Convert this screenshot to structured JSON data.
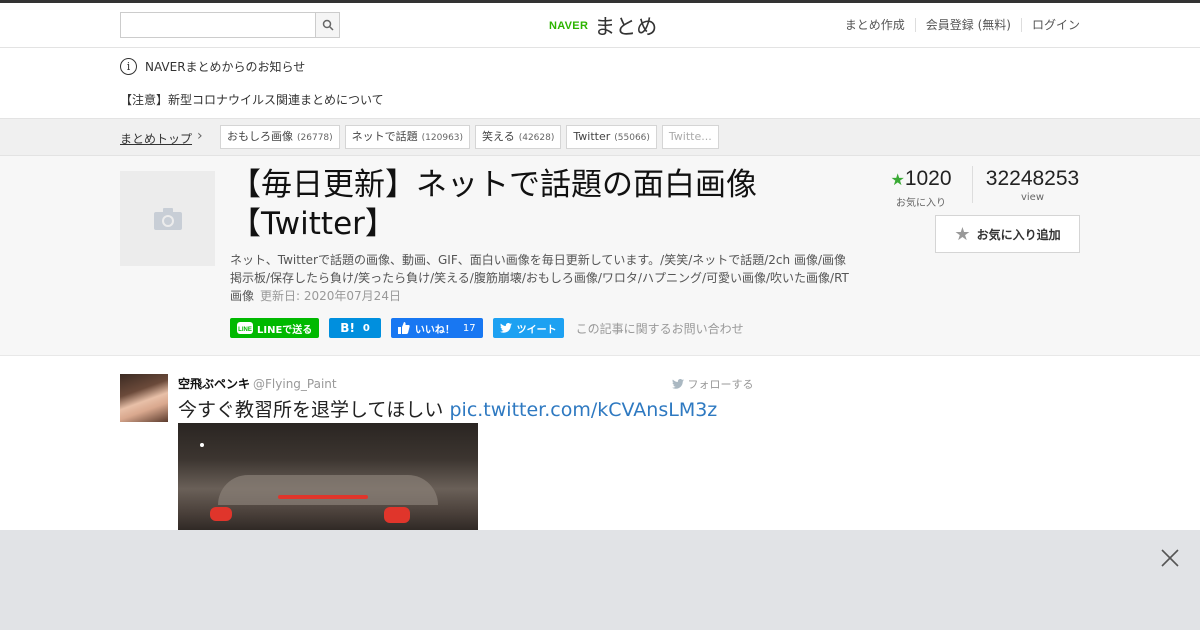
{
  "header": {
    "search_placeholder": "",
    "logo_naver": "NAVER",
    "logo_matome": "まとめ",
    "nav": [
      "まとめ作成",
      "会員登録 (無料)",
      "ログイン"
    ]
  },
  "notice": {
    "title": "NAVERまとめからのお知らせ",
    "link": "【注意】新型コロナウイルス関連まとめについて"
  },
  "breadcrumb": {
    "top": "まとめトップ",
    "tags": [
      {
        "label": "おもしろ画像",
        "count": "(26778)"
      },
      {
        "label": "ネットで話題",
        "count": "(120963)"
      },
      {
        "label": "笑える",
        "count": "(42628)"
      },
      {
        "label": "Twitter",
        "count": "(55066)"
      },
      {
        "label": "Twitte...",
        "count": ""
      }
    ]
  },
  "article": {
    "title_line1": "【毎日更新】ネットで話題の面白画像",
    "title_line2": "【Twitter】",
    "description": "ネット、Twitterで話題の画像、動画、GIF、面白い画像を毎日更新しています。/笑笑/ネットで話題/2ch 画像/画像掲示板/保存したら負け/笑ったら負け/笑える/腹筋崩壊/おもしろ画像/ワロタ/ハプニング/可愛い画像/吹いた画像/RT画像",
    "updated": "更新日: 2020年07月24日",
    "favorites": "1020",
    "favorites_label": "お気に入り",
    "views": "32248253",
    "views_label": "view",
    "fav_button": "お気に入り追加",
    "share": {
      "line": "LINEで送る",
      "hatena_count": "0",
      "fb_label": "いいね！",
      "fb_count": "17",
      "tweet": "ツイート"
    },
    "contact": "この記事に関するお問い合わせ"
  },
  "tweet": {
    "name": "空飛ぶペンキ",
    "handle": "@Flying_Paint",
    "follow": "フォローする",
    "text": "今すぐ教習所を退学してほしい",
    "link": "pic.twitter.com/kCVAnsLM3z"
  },
  "colors": {
    "naver_green": "#2db400",
    "line_green": "#00b900",
    "hatena_blue": "#008fde",
    "fb_blue": "#1877f2",
    "twitter_blue": "#1da1f2",
    "link_blue": "#2e79c1"
  }
}
